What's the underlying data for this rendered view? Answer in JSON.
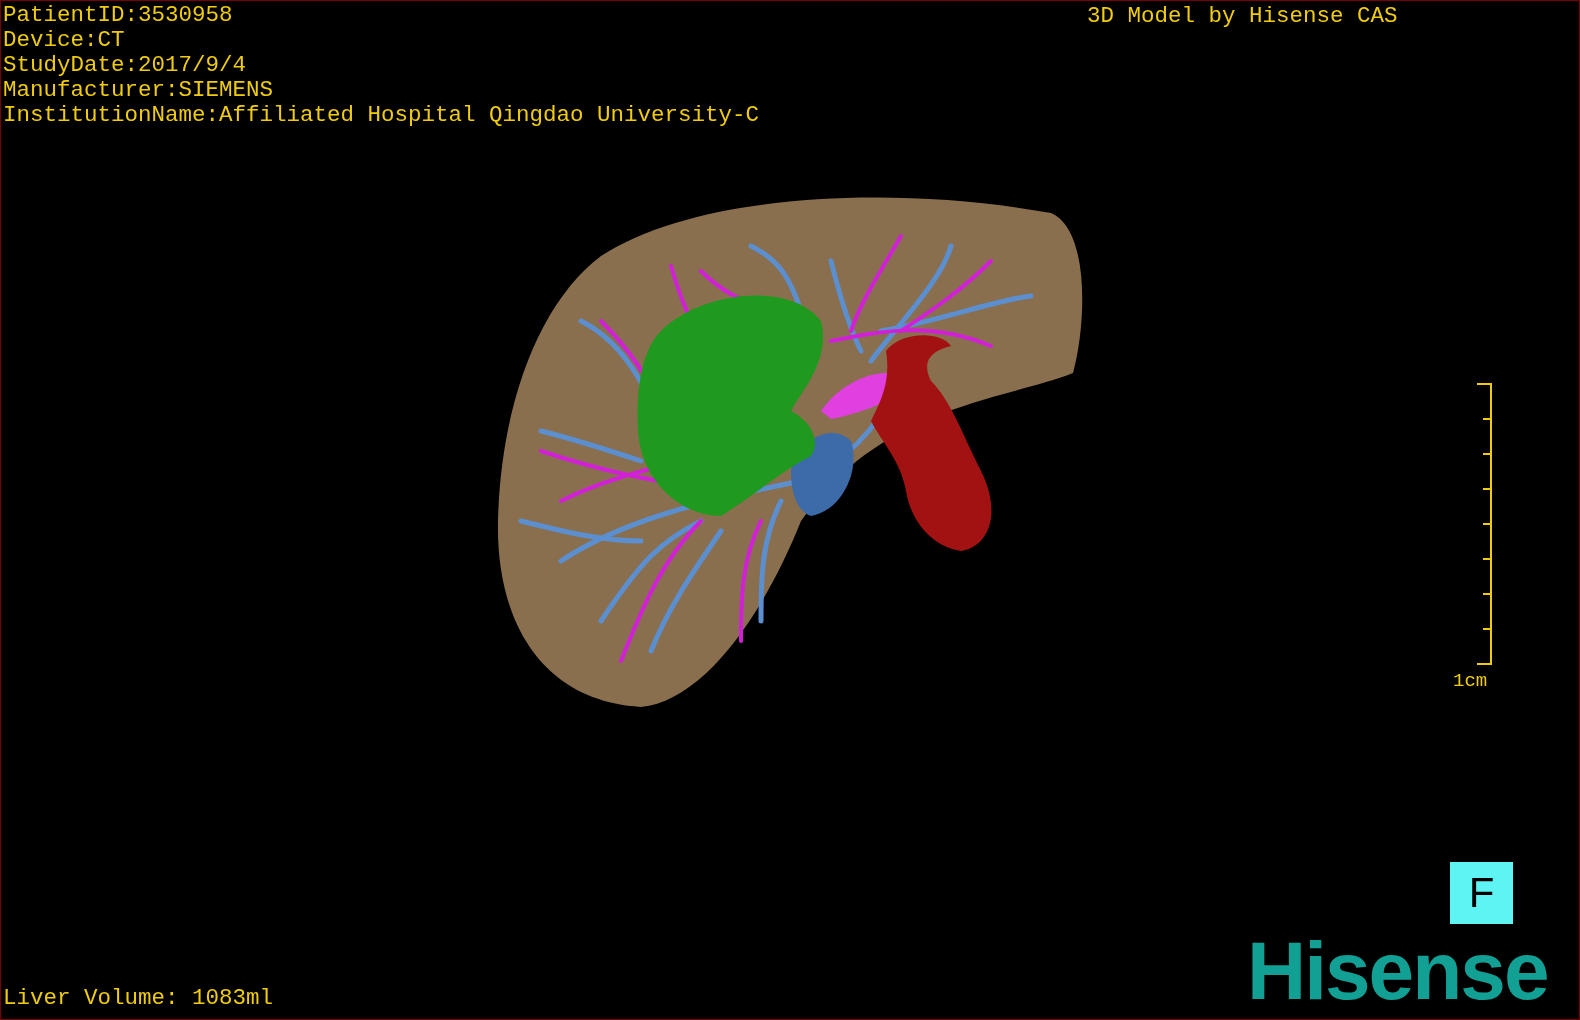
{
  "overlay_info": [
    "PatientID:3530958",
    "Device:CT",
    "StudyDate:2017/9/4",
    "Manufacturer:SIEMENS",
    "InstitutionName:Affiliated Hospital Qingdao University-C"
  ],
  "credit": "3D Model by Hisense CAS",
  "scale_bar": {
    "label": "1cm"
  },
  "orientation_marker": "F",
  "volume": "Liver Volume: 1083ml",
  "logo": "Hisense"
}
